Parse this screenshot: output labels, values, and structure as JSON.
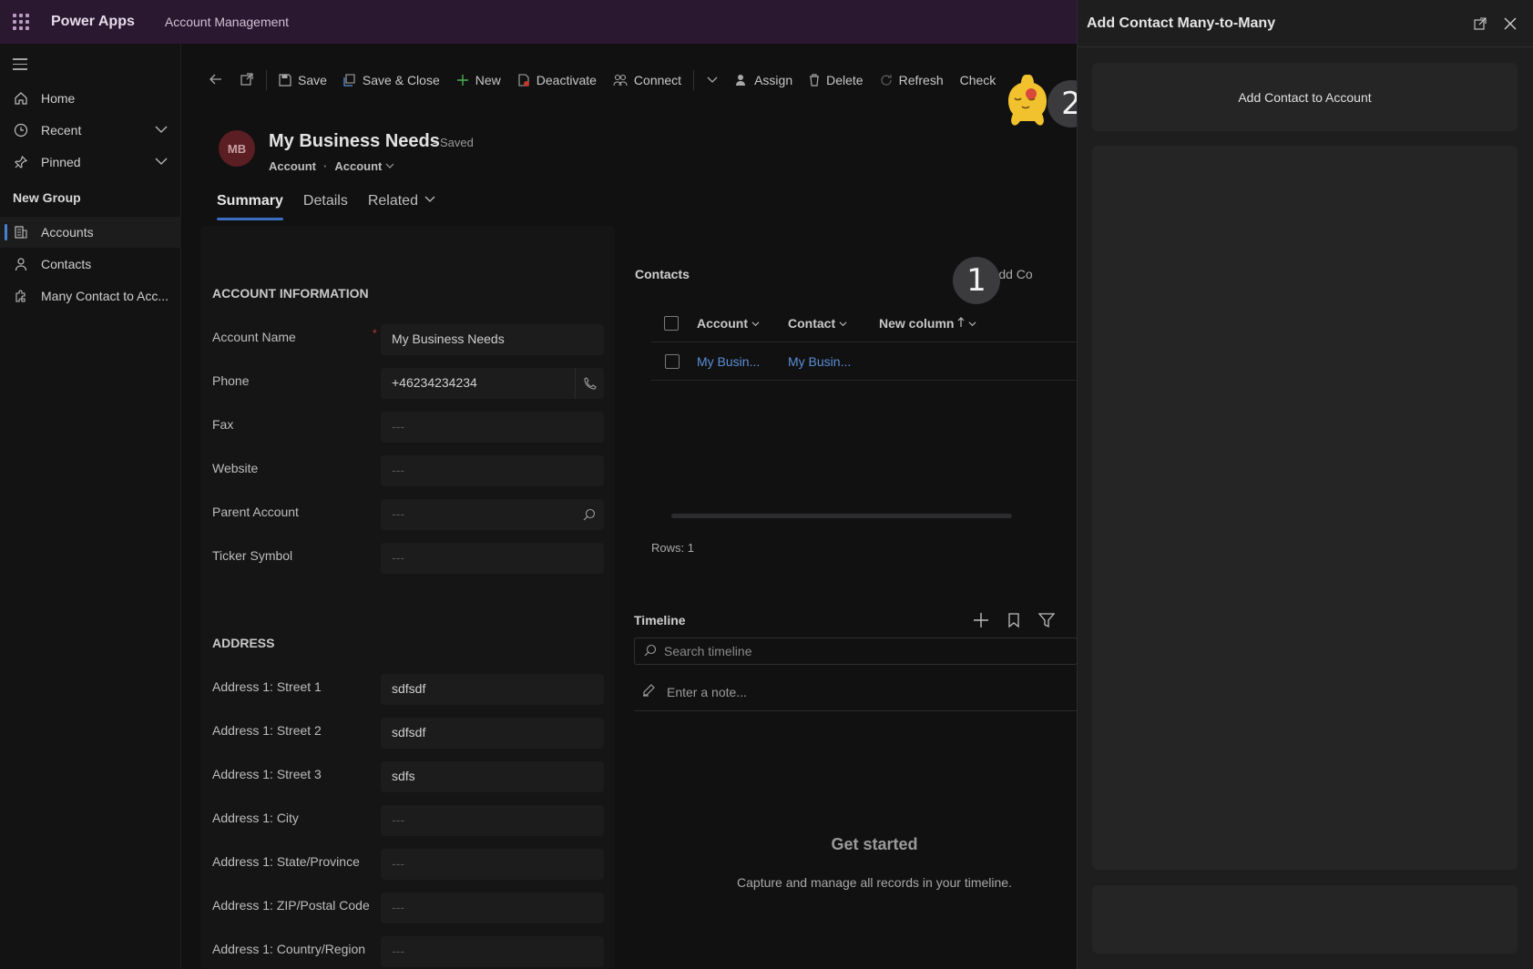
{
  "topbar": {
    "app_name": "Power Apps",
    "area": "Account Management"
  },
  "nav": {
    "home": "Home",
    "recent": "Recent",
    "pinned": "Pinned",
    "group": "New Group",
    "accounts": "Accounts",
    "contacts": "Contacts",
    "many": "Many Contact to Acc..."
  },
  "commands": {
    "save": "Save",
    "save_close": "Save & Close",
    "new": "New",
    "deactivate": "Deactivate",
    "connect": "Connect",
    "assign": "Assign",
    "delete": "Delete",
    "refresh": "Refresh",
    "check": "Check"
  },
  "record": {
    "initials": "MB",
    "title": "My Business Needs",
    "status": "- Saved",
    "entity": "Account",
    "form": "Account"
  },
  "tabs": {
    "summary": "Summary",
    "details": "Details",
    "related": "Related"
  },
  "form": {
    "section_account": "ACCOUNT INFORMATION",
    "section_address": "ADDRESS",
    "fields": [
      {
        "label": "Account Name",
        "value": "My Business Needs"
      },
      {
        "label": "Phone",
        "value": "+46234234234"
      },
      {
        "label": "Fax",
        "value": "---"
      },
      {
        "label": "Website",
        "value": "---"
      },
      {
        "label": "Parent Account",
        "value": "---"
      },
      {
        "label": "Ticker Symbol",
        "value": "---"
      }
    ],
    "address": [
      {
        "label": "Address 1: Street 1",
        "value": "sdfsdf"
      },
      {
        "label": "Address 1: Street 2",
        "value": "sdfsdf"
      },
      {
        "label": "Address 1: Street 3",
        "value": "sdfs"
      },
      {
        "label": "Address 1: City",
        "value": "---"
      },
      {
        "label": "Address 1: State/Province",
        "value": "---"
      },
      {
        "label": "Address 1: ZIP/Postal Code",
        "value": "---"
      },
      {
        "label": "Address 1: Country/Region",
        "value": "---"
      }
    ]
  },
  "contacts": {
    "title": "Contacts",
    "add_label": "Add Co",
    "columns": [
      "Account",
      "Contact",
      "New column"
    ],
    "rows": [
      {
        "account": "My Busin...",
        "contact": "My Busin..."
      }
    ],
    "rows_count": "Rows: 1"
  },
  "timeline": {
    "title": "Timeline",
    "search_placeholder": "Search timeline",
    "note_placeholder": "Enter a note...",
    "empty_title": "Get started",
    "empty_sub": "Capture and manage all records in your timeline."
  },
  "badges": {
    "one": "1",
    "two": "2"
  },
  "panel": {
    "title": "Add Contact Many-to-Many",
    "card_text": "Add Contact to Account"
  },
  "colors": {
    "topbar": "#2a1730",
    "accent": "#3a6fc4",
    "link": "#5b8fd6",
    "mascot": "#f2c12e"
  }
}
